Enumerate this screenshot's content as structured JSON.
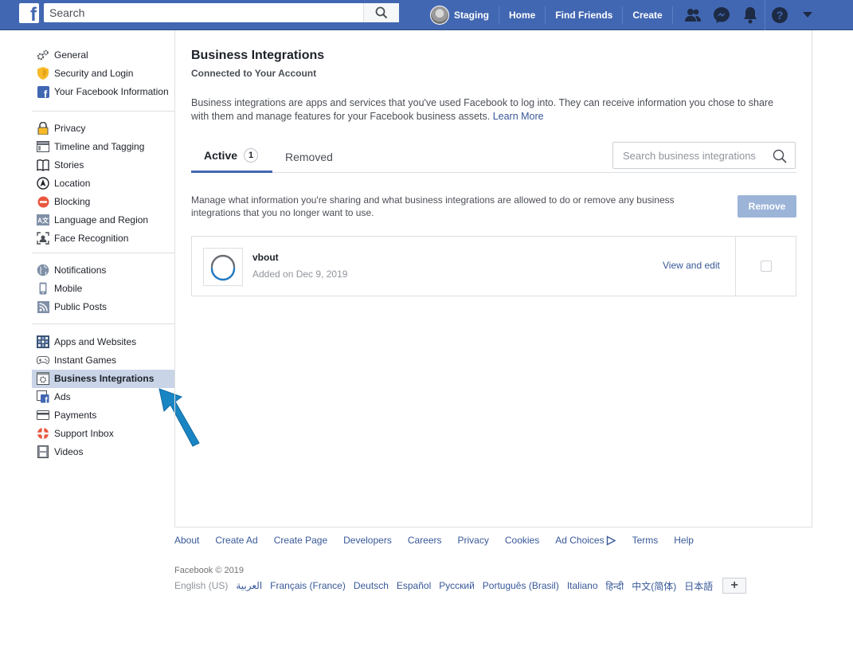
{
  "topbar": {
    "search_placeholder": "Search",
    "profile_name": "Staging",
    "nav": [
      "Home",
      "Find Friends",
      "Create"
    ],
    "icons": [
      "friends-icon",
      "messenger-icon",
      "notifications-icon",
      "help-icon",
      "dropdown-icon"
    ],
    "brand_color": "#4267b2"
  },
  "sidebar": {
    "groups": [
      [
        {
          "label": "General",
          "icon": "gear-icon"
        },
        {
          "label": "Security and Login",
          "icon": "shield-icon"
        },
        {
          "label": "Your Facebook Information",
          "icon": "facebook-icon"
        }
      ],
      [
        {
          "label": "Privacy",
          "icon": "lock-icon"
        },
        {
          "label": "Timeline and Tagging",
          "icon": "timeline-icon"
        },
        {
          "label": "Stories",
          "icon": "book-icon"
        },
        {
          "label": "Location",
          "icon": "location-icon"
        },
        {
          "label": "Blocking",
          "icon": "block-icon"
        },
        {
          "label": "Language and Region",
          "icon": "language-icon"
        },
        {
          "label": "Face Recognition",
          "icon": "face-icon"
        }
      ],
      [
        {
          "label": "Notifications",
          "icon": "globe-icon"
        },
        {
          "label": "Mobile",
          "icon": "mobile-icon"
        },
        {
          "label": "Public Posts",
          "icon": "rss-icon"
        }
      ],
      [
        {
          "label": "Apps and Websites",
          "icon": "apps-icon"
        },
        {
          "label": "Instant Games",
          "icon": "gamepad-icon"
        },
        {
          "label": "Business Integrations",
          "icon": "business-icon"
        },
        {
          "label": "Ads",
          "icon": "ads-icon"
        },
        {
          "label": "Payments",
          "icon": "card-icon"
        },
        {
          "label": "Support Inbox",
          "icon": "lifebuoy-icon"
        },
        {
          "label": "Videos",
          "icon": "film-icon"
        }
      ]
    ],
    "active": "Business Integrations",
    "active_bg": "#c9d4e6"
  },
  "main": {
    "title": "Business Integrations",
    "subtitle": "Connected to Your Account",
    "description": "Business integrations are apps and services that you've used Facebook to log into. They can receive information you chose to share with them and manage features for your Facebook business assets.",
    "learn_more": "Learn More",
    "tabs": [
      {
        "label": "Active",
        "count": "1"
      },
      {
        "label": "Removed"
      }
    ],
    "search_placeholder": "Search business integrations",
    "manage_text": "Manage what information you're sharing and what business integrations are allowed to do or remove any business integrations that you no longer want to use.",
    "remove_label": "Remove",
    "integrations": [
      {
        "name": "vbout",
        "added": "Added on Dec 9, 2019",
        "action": "View and edit",
        "checked": false
      }
    ]
  },
  "footer": {
    "links": [
      "About",
      "Create Ad",
      "Create Page",
      "Developers",
      "Careers",
      "Privacy",
      "Cookies",
      "Ad Choices",
      "Terms",
      "Help"
    ],
    "copyright": "Facebook © 2019",
    "current_language": "English (US)",
    "languages": [
      "العربية",
      "Français (France)",
      "Deutsch",
      "Español",
      "Русский",
      "Português (Brasil)",
      "Italiano",
      "हिन्दी",
      "中文(简体)",
      "日本語"
    ],
    "more_languages": "+"
  }
}
